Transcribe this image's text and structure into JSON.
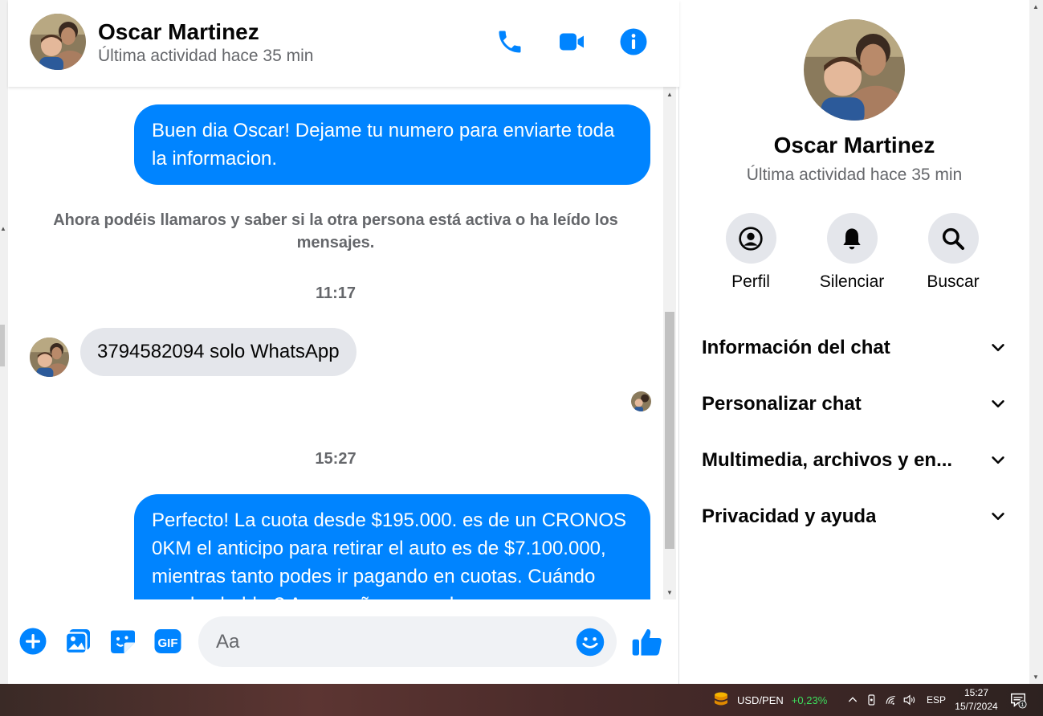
{
  "header": {
    "contact_name": "Oscar Martinez",
    "status": "Última actividad hace 35 min",
    "actions": [
      "phone-icon",
      "video-call-icon",
      "info-icon"
    ]
  },
  "messages": {
    "outgoing_1": "Buen dia Oscar! Dejame tu numero para enviarte toda la informacion.",
    "system_note": "Ahora podéis llamaros y saber si la otra persona está activa o ha leído los mensajes.",
    "time_1": "11:17",
    "incoming_1": "3794582094 solo WhatsApp",
    "time_2": "15:27",
    "outgoing_2": "Perfecto! La cuota desde $195.000. es de un CRONOS 0KM el anticipo para retirar el auto es de $7.100.000, mientras tanto podes ir pagando en cuotas. Cuándo puedes hablar? Acompañamos en la"
  },
  "composer": {
    "placeholder": "Aa",
    "icons": [
      "add-icon",
      "gallery-icon",
      "sticker-icon",
      "gif-icon",
      "emoji-icon",
      "like-icon"
    ],
    "gif_label": "GIF"
  },
  "profile_panel": {
    "name": "Oscar Martinez",
    "status": "Última actividad hace 35 min",
    "actions": [
      {
        "label": "Perfil",
        "icon": "profile-icon"
      },
      {
        "label": "Silenciar",
        "icon": "bell-icon"
      },
      {
        "label": "Buscar",
        "icon": "search-icon"
      }
    ],
    "sections": [
      {
        "label": "Información del chat"
      },
      {
        "label": "Personalizar chat"
      },
      {
        "label": "Multimedia, archivos y en..."
      },
      {
        "label": "Privacidad y ayuda"
      }
    ]
  },
  "taskbar": {
    "stock_symbol": "USD/PEN",
    "stock_change": "+0,23%",
    "language": "ESP",
    "time": "15:27",
    "date": "15/7/2024",
    "notification_count": "1"
  },
  "colors": {
    "messenger_blue": "#0084ff",
    "incoming_bubble": "#e4e6eb",
    "secondary_text": "#65676b"
  }
}
